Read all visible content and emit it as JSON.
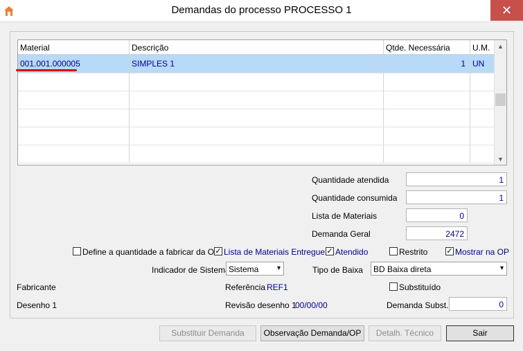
{
  "window": {
    "title": "Demandas do processo PROCESSO 1",
    "close_glyph": "✕"
  },
  "grid": {
    "columns": [
      "Material",
      "Descrição",
      "Qtde. Necessária",
      "U.M."
    ],
    "rows": [
      {
        "material": "001.001.000005",
        "descricao": "SIMPLES 1",
        "qtde": "1",
        "um": "UN"
      }
    ]
  },
  "fields": {
    "quantidade_atendida": {
      "label": "Quantidade atendida",
      "value": "1"
    },
    "quantidade_consumida": {
      "label": "Quantidade consumida",
      "value": "1"
    },
    "lista_materiais": {
      "label": "Lista de Materiais",
      "value": "0"
    },
    "demanda_geral": {
      "label": "Demanda Geral",
      "value": "2472"
    }
  },
  "checkboxes": {
    "define_qtd": {
      "label": "Define a quantidade a fabricar da OP",
      "checked": false
    },
    "lista_entregue": {
      "label": "Lista de Materiais Entregue",
      "checked": true
    },
    "atendido": {
      "label": "Atendido",
      "checked": true
    },
    "restrito": {
      "label": "Restrito",
      "checked": false
    },
    "mostrar_op": {
      "label": "Mostrar na OP",
      "checked": true
    },
    "substituido": {
      "label": "Substituído",
      "checked": false
    }
  },
  "selects": {
    "indicador": {
      "label": "Indicador de Sistema",
      "value": "Sistema"
    },
    "tipo_baixa": {
      "label": "Tipo de Baixa",
      "value": "BD Baixa direta"
    }
  },
  "info": {
    "fabricante": "Fabricante",
    "referencia_label": "Referência",
    "referencia_value": "REF1",
    "desenho_label": "Desenho 1",
    "revisao_label": "Revisão desenho 1",
    "revisao_value": "00/00/00",
    "demanda_subst_label": "Demanda Subst.",
    "demanda_subst_value": "0"
  },
  "buttons": {
    "substituir": "Substituir Demanda",
    "observacao": "Observação Demanda/OP",
    "detalh": "Detalh. Técnico",
    "sair": "Sair"
  },
  "check_glyph": "✓",
  "colors": {
    "accent_text": "#00008b",
    "selection": "#b8d9f7",
    "close": "#c7504a",
    "annotation": "#e00000"
  }
}
